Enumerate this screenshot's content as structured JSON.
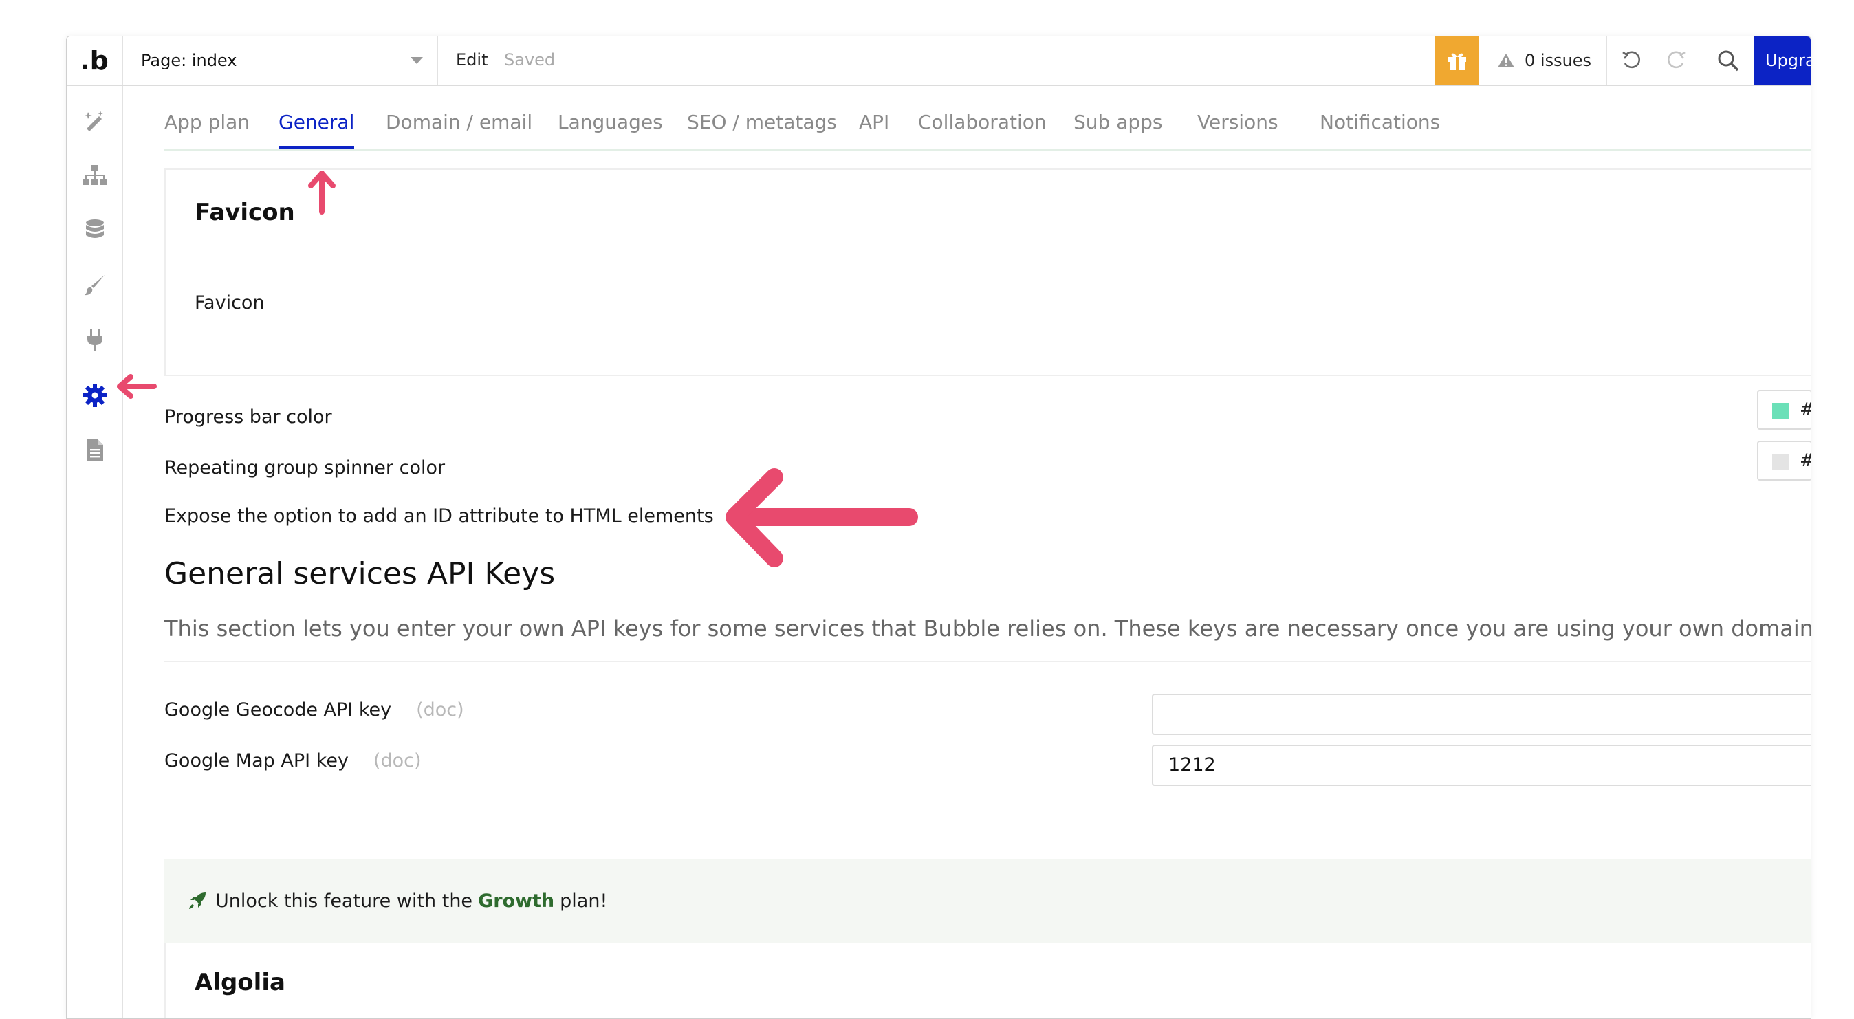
{
  "topbar": {
    "logo": ".b",
    "page_select": "Page: index",
    "edit": "Edit",
    "saved": "Saved",
    "issues": "0 issues",
    "upgrade": "Upgra"
  },
  "sidebar": {
    "items": [
      {
        "icon": "design-icon"
      },
      {
        "icon": "workflow-icon"
      },
      {
        "icon": "data-icon"
      },
      {
        "icon": "styles-icon"
      },
      {
        "icon": "plugins-icon"
      },
      {
        "icon": "settings-icon",
        "active": true
      },
      {
        "icon": "logs-icon"
      }
    ]
  },
  "tabs": [
    {
      "label": "App plan"
    },
    {
      "label": "General",
      "active": true
    },
    {
      "label": "Domain / email"
    },
    {
      "label": "Languages"
    },
    {
      "label": "SEO / metatags"
    },
    {
      "label": "API"
    },
    {
      "label": "Collaboration"
    },
    {
      "label": "Sub apps"
    },
    {
      "label": "Versions"
    },
    {
      "label": "Notifications"
    }
  ],
  "favicon": {
    "title": "Favicon",
    "label": "Favicon"
  },
  "settings": {
    "progress_bar_color": "Progress bar color",
    "progress_bar_hash": "#",
    "progress_swatch_color": "#6be0b8",
    "spinner_color": "Repeating group spinner color",
    "spinner_hash": "#",
    "spinner_swatch_color": "#e4e4e4",
    "expose_id": "Expose the option to add an ID attribute to HTML elements"
  },
  "api_keys": {
    "title": "General services API Keys",
    "description": "This section lets you enter your own API keys for some services that Bubble relies on. These keys are necessary once you are using your own domain.",
    "geocode_label": "Google Geocode API key",
    "geocode_doc": "(doc)",
    "geocode_value": "",
    "map_label": "Google Map API key",
    "map_doc": "(doc)",
    "map_value": "1212"
  },
  "banner": {
    "prefix": "Unlock this feature with the",
    "plan": "Growth",
    "suffix": "plan!"
  },
  "algolia": {
    "title": "Algolia"
  },
  "colors": {
    "accent": "#0c23c5",
    "gift": "#f0a830",
    "annotation_arrow": "#e84a6e",
    "growth": "#2e6b2e"
  }
}
